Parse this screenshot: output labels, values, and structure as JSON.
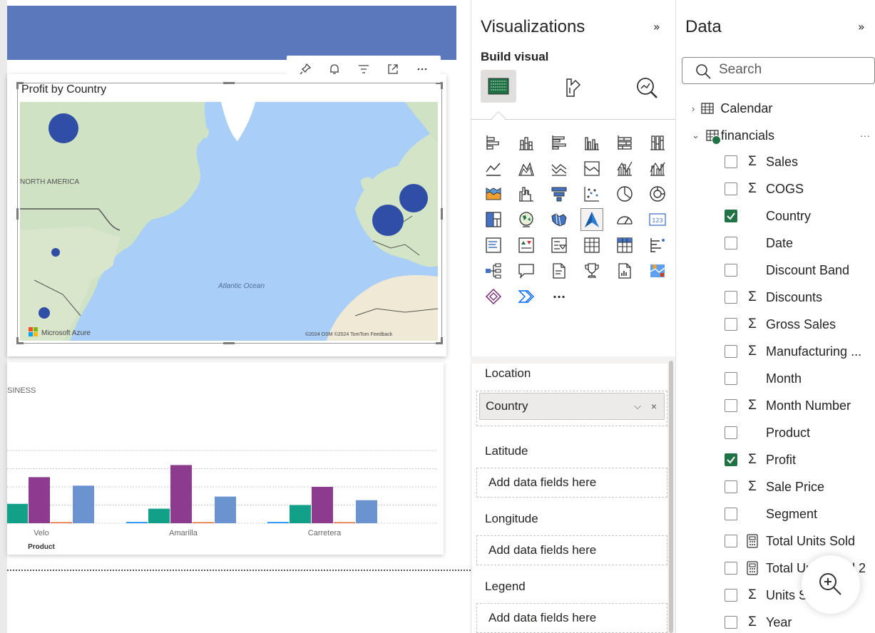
{
  "canvas": {
    "map_visual": {
      "title": "Profit by Country",
      "labels": {
        "north_america": "NORTH AMERICA",
        "ocean": "Atlantic Ocean"
      },
      "attribution_left": "Microsoft Azure",
      "attribution_right": "©2024 OSM ©2024 TomTom Feedback"
    },
    "bar_visual": {
      "header_fragment": "SINESS",
      "x_axis_title": "Product",
      "chart_data": {
        "type": "bar",
        "categories": [
          "Velo",
          "Amarilla",
          "Carretera"
        ],
        "series": [
          {
            "name": "",
            "color": "#118dff",
            "values": [
              0,
              1,
              1
            ]
          },
          {
            "name": "",
            "color": "#12a089",
            "values": [
              16,
              12,
              15
            ]
          },
          {
            "name": "",
            "color": "#8d3b8e",
            "values": [
              38,
              48,
              30
            ]
          },
          {
            "name": "",
            "color": "#e66c37",
            "values": [
              0.5,
              0.5,
              0.5
            ]
          },
          {
            "name": "",
            "color": "#6b93cf",
            "values": [
              31,
              22,
              19
            ]
          }
        ],
        "xlabel": "Product",
        "ylabel": "",
        "grid": true
      }
    },
    "header_icons": [
      "pin-icon",
      "bell-icon",
      "filter-icon",
      "focus-mode-icon",
      "more-options-icon"
    ]
  },
  "visualizations": {
    "title": "Visualizations",
    "subtitle": "Build visual",
    "more_label": "···",
    "wells": {
      "location_label": "Location",
      "location_value": "Country",
      "latitude_label": "Latitude",
      "latitude_placeholder": "Add data fields here",
      "longitude_label": "Longitude",
      "longitude_placeholder": "Add data fields here",
      "legend_label": "Legend",
      "legend_placeholder": "Add data fields here"
    }
  },
  "data": {
    "title": "Data",
    "search_placeholder": "Search",
    "tables": [
      {
        "name": "Calendar",
        "expanded": false
      },
      {
        "name": "financials",
        "expanded": true,
        "more": "···"
      }
    ],
    "fields": [
      {
        "name": "Sales",
        "type": "sigma",
        "checked": false
      },
      {
        "name": "COGS",
        "type": "sigma",
        "checked": false
      },
      {
        "name": "Country",
        "type": "none",
        "checked": true
      },
      {
        "name": "Date",
        "type": "none",
        "checked": false
      },
      {
        "name": "Discount Band",
        "type": "none",
        "checked": false
      },
      {
        "name": "Discounts",
        "type": "sigma",
        "checked": false
      },
      {
        "name": "Gross Sales",
        "type": "sigma",
        "checked": false
      },
      {
        "name": "Manufacturing ...",
        "type": "sigma",
        "checked": false
      },
      {
        "name": "Month",
        "type": "none",
        "checked": false
      },
      {
        "name": "Month Number",
        "type": "sigma",
        "checked": false
      },
      {
        "name": "Product",
        "type": "none",
        "checked": false
      },
      {
        "name": "Profit",
        "type": "sigma",
        "checked": true
      },
      {
        "name": "Sale Price",
        "type": "sigma",
        "checked": false
      },
      {
        "name": "Segment",
        "type": "none",
        "checked": false
      },
      {
        "name": "Total Units Sold",
        "type": "calc",
        "checked": false
      },
      {
        "name": "Total Units Sold 2",
        "type": "calc",
        "checked": false
      },
      {
        "name": "Units Sold",
        "type": "sigma",
        "checked": false
      },
      {
        "name": "Year",
        "type": "sigma",
        "checked": false
      }
    ]
  }
}
